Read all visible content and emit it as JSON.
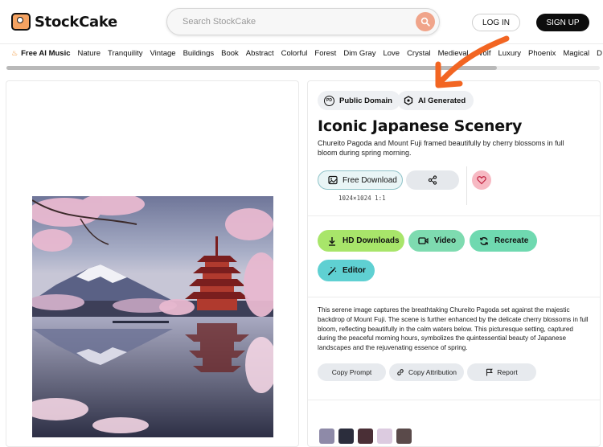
{
  "header": {
    "logo_text": "StockCake",
    "search_placeholder": "Search StockCake",
    "login_label": "LOG IN",
    "signup_label": "SIGN UP"
  },
  "categories": {
    "featured": "Free AI Music",
    "items": [
      "Nature",
      "Tranquility",
      "Vintage",
      "Buildings",
      "Book",
      "Abstract",
      "Colorful",
      "Forest",
      "Dim Gray",
      "Love",
      "Crystal",
      "Medieval",
      "Wolf",
      "Luxury",
      "Phoenix",
      "Magical",
      "D"
    ]
  },
  "image": {
    "alt": "Iconic Japanese Scenery"
  },
  "details": {
    "chip_public_domain": "Public Domain",
    "chip_ai_generated": "AI Generated",
    "title": "Iconic Japanese Scenery",
    "subtitle": "Chureito Pagoda and Mount Fuji framed beautifully by cherry blossoms in full bloom during spring morning.",
    "free_download_label": "Free Download",
    "dimensions": "1024×1024 1:1",
    "hd_downloads_label": "HD Downloads",
    "video_label": "Video",
    "recreate_label": "Recreate",
    "editor_label": "Editor",
    "description": "This serene image captures the breathtaking Chureito Pagoda set against the majestic backdrop of Mount Fuji. The scene is further enhanced by the delicate cherry blossoms in full bloom, reflecting beautifully in the calm waters below. This picturesque setting, captured during the peaceful morning hours, symbolizes the quintessential beauty of Japanese landscapes and the rejuvenating essence of spring.",
    "copy_prompt_label": "Copy Prompt",
    "copy_attribution_label": "Copy Attribution",
    "report_label": "Report"
  },
  "palette": [
    "#8e8aa8",
    "#2b2d3c",
    "#4a2f36",
    "#dccbe0",
    "#5a4a4a"
  ],
  "icons": {
    "search": "search-icon",
    "share": "share-icon",
    "heart": "heart-icon",
    "image": "image-icon",
    "download": "download-icon",
    "video": "video-icon",
    "recreate": "refresh-icon",
    "editor": "magic-wand-icon",
    "link": "link-icon",
    "flag": "flag-icon"
  },
  "colors": {
    "accent_orange": "#f26522",
    "hd_green": "#a8e56a",
    "video_green": "#7edbb0",
    "recreate_teal": "#6fd9b0",
    "editor_cyan": "#5fd0d2",
    "heart_pink": "#f7b9c3"
  }
}
